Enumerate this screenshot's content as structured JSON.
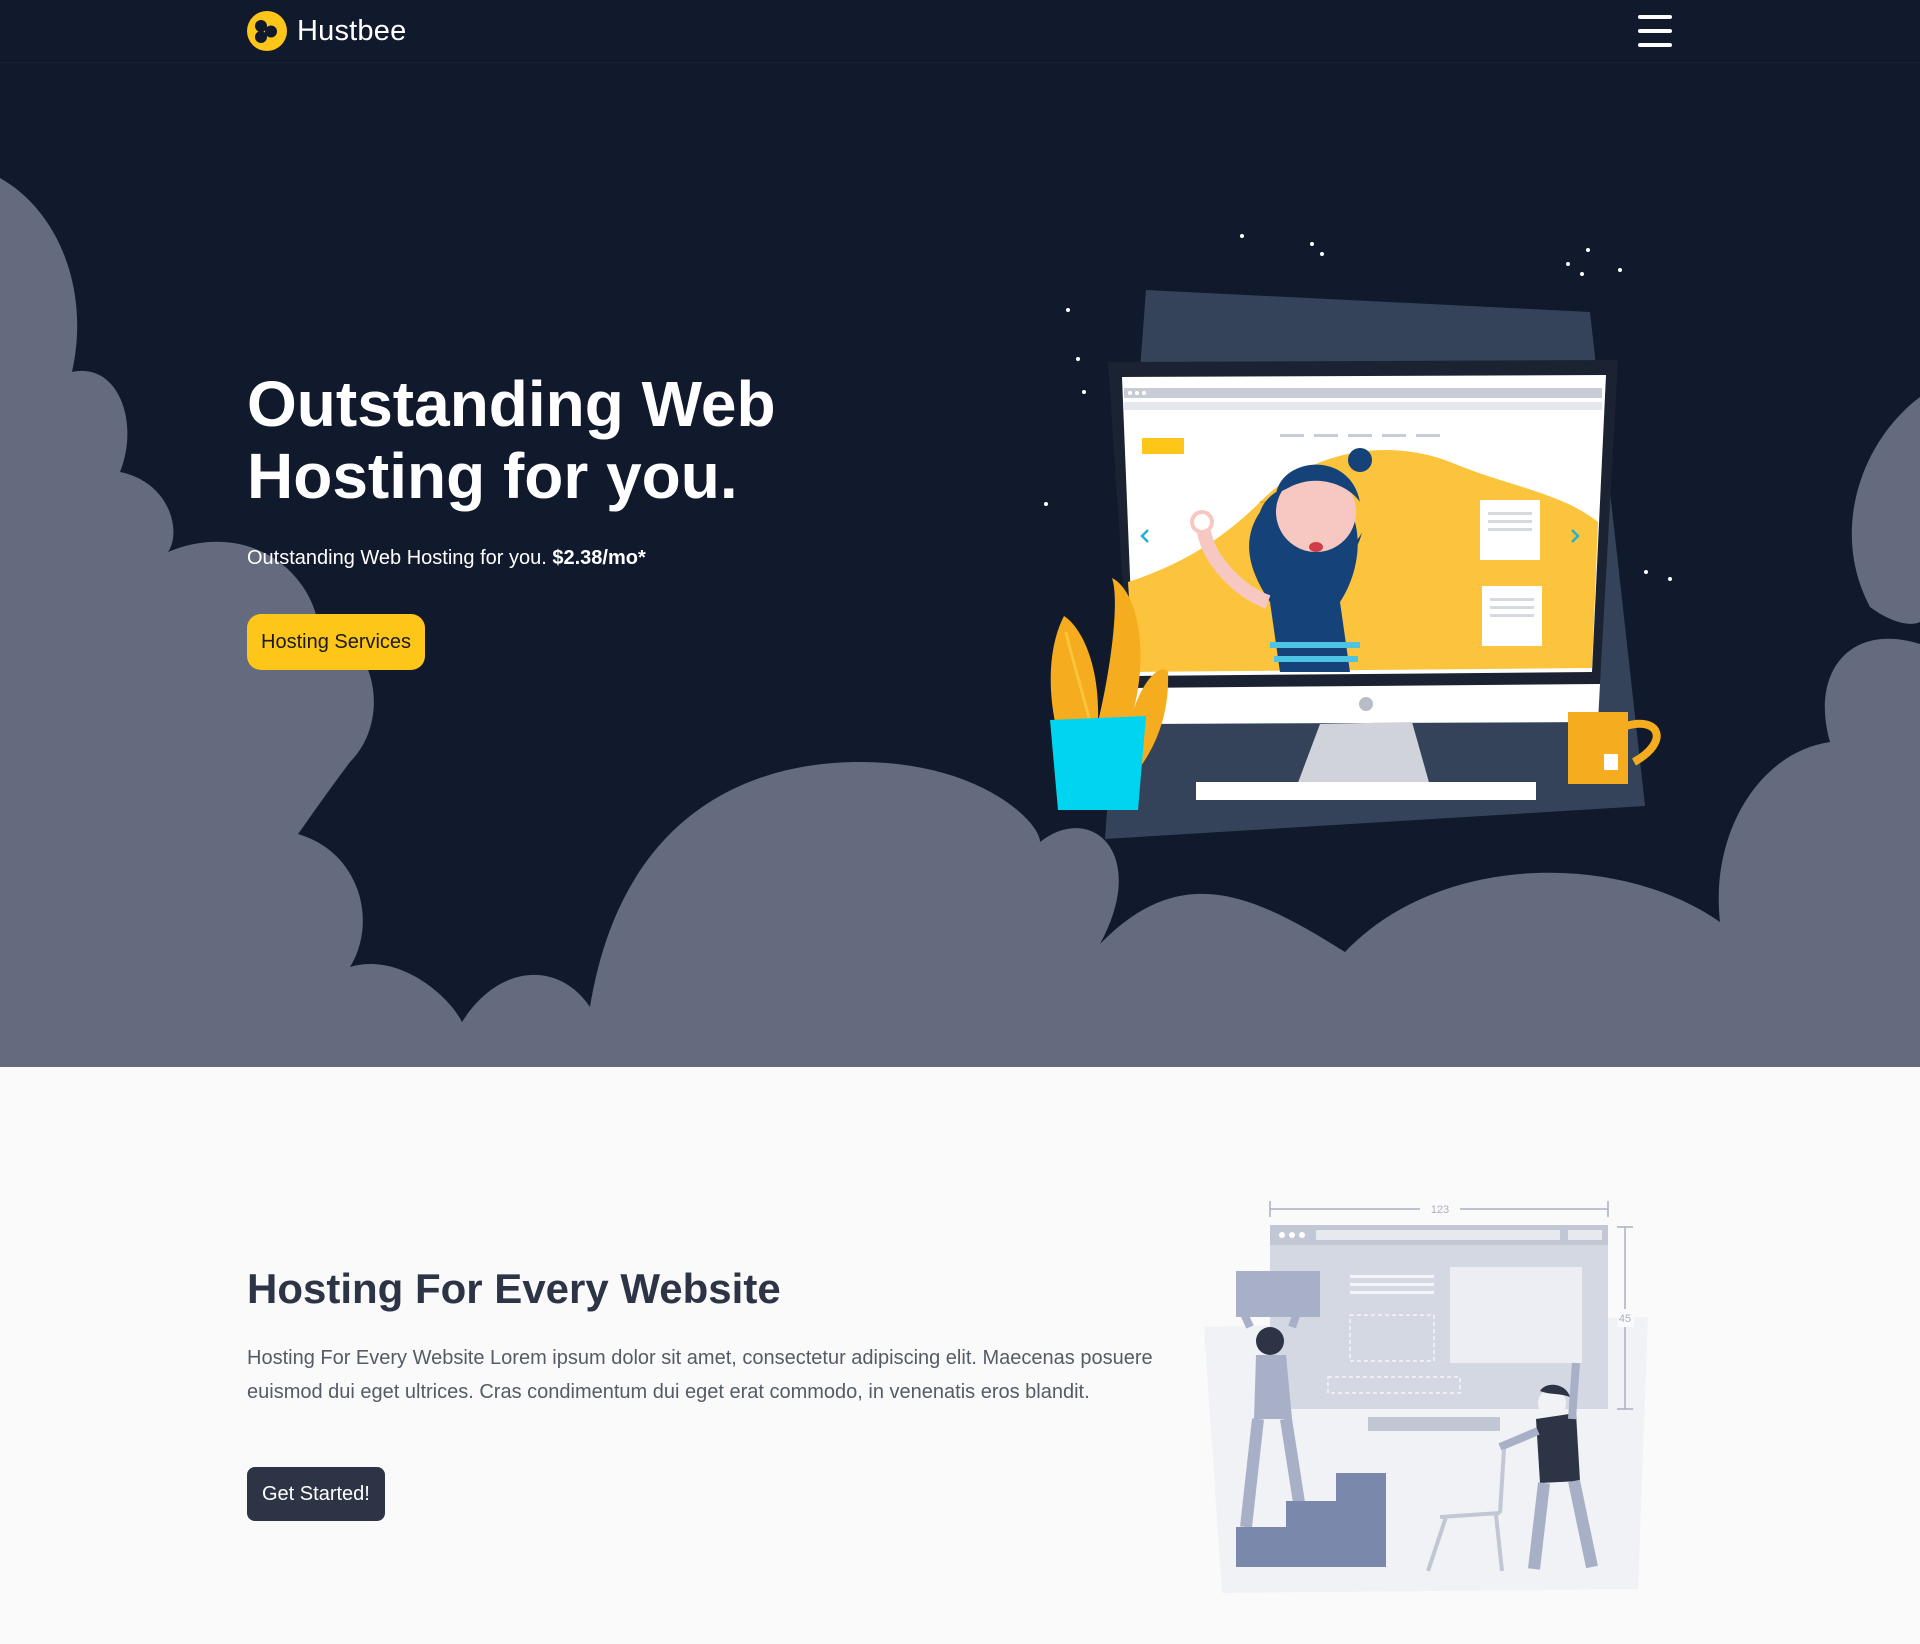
{
  "navbar": {
    "brand_name": "Hustbee",
    "menu_icon": "hamburger-menu-icon",
    "logo_icon": "honeycomb-logo-icon"
  },
  "hero": {
    "title": "Outstanding Web Hosting for you.",
    "subtitle_text": "Outstanding Web Hosting for you.",
    "subtitle_price": "$2.38/mo*",
    "cta_label": "Hosting Services",
    "illustration_icon": "bearded-man-computer-illustration"
  },
  "section2": {
    "title": "Hosting For Every Website",
    "text": "Hosting For Every Website Lorem ipsum dolor sit amet, consectetur adipiscing elit. Maecenas posuere euismod dui eget ultrices. Cras condimentum dui eget erat commodo, in venenatis eros blandit.",
    "cta_label": "Get Started!",
    "illustration_icon": "people-building-website-illustration",
    "dim_width": "123",
    "dim_height": "45"
  },
  "colors": {
    "dark_bg": "#111a2c",
    "cloud": "#646b7e",
    "accent_yellow": "#ffc61a",
    "button_dark": "#2d3446",
    "light_bg": "#fafafa"
  }
}
